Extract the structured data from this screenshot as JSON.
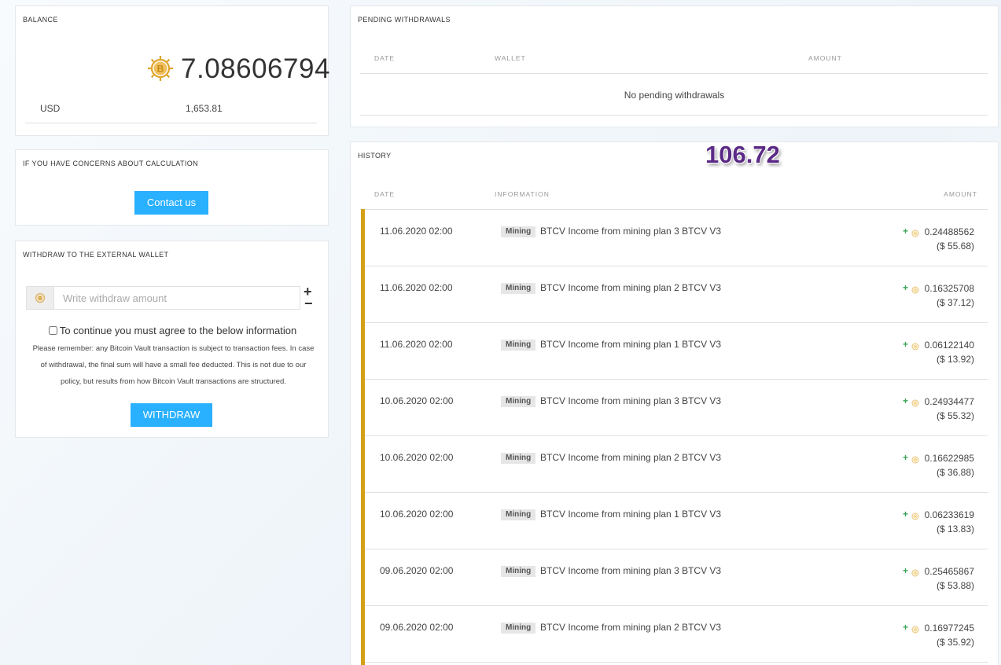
{
  "balance": {
    "title": "BALANCE",
    "amount": "7.08606794",
    "coin_icon": "bitcoin-vault-icon",
    "usd_label": "USD",
    "usd_value": "1,653.81"
  },
  "concerns": {
    "title": "IF YOU HAVE CONCERNS ABOUT CALCULATION",
    "contact_label": "Contact us"
  },
  "withdraw": {
    "title": "WITHDRAW TO THE EXTERNAL WALLET",
    "placeholder": "Write withdraw amount",
    "plus": "+",
    "minus": "−",
    "agree_label": "To continue you must agree to the below information",
    "notice": "Please remember: any Bitcoin Vault transaction is subject to transaction fees. In case of withdrawal, the final sum will have a small fee deducted. This is not due to our policy, but results from how Bitcoin Vault transactions are structured.",
    "button_label": "WITHDRAW"
  },
  "pending": {
    "title": "PENDING WITHDRAWALS",
    "columns": [
      "DATE",
      "WALLET",
      "AMOUNT"
    ],
    "empty_text": "No pending withdrawals"
  },
  "history": {
    "title": "HISTORY",
    "overlay_value": "106.72",
    "columns": [
      "DATE",
      "INFORMATION",
      "AMOUNT"
    ],
    "rows": [
      {
        "date": "11.06.2020 02:00",
        "badge": "Mining",
        "info": "BTCV Income from mining plan 3 BTCV V3",
        "sign": "+",
        "amount": "0.24488562",
        "usd": "($ 55.68)"
      },
      {
        "date": "11.06.2020 02:00",
        "badge": "Mining",
        "info": "BTCV Income from mining plan 2 BTCV V3",
        "sign": "+",
        "amount": "0.16325708",
        "usd": "($ 37.12)"
      },
      {
        "date": "11.06.2020 02:00",
        "badge": "Mining",
        "info": "BTCV Income from mining plan 1 BTCV V3",
        "sign": "+",
        "amount": "0.06122140",
        "usd": "($ 13.92)"
      },
      {
        "date": "10.06.2020 02:00",
        "badge": "Mining",
        "info": "BTCV Income from mining plan 3 BTCV V3",
        "sign": "+",
        "amount": "0.24934477",
        "usd": "($ 55.32)"
      },
      {
        "date": "10.06.2020 02:00",
        "badge": "Mining",
        "info": "BTCV Income from mining plan 2 BTCV V3",
        "sign": "+",
        "amount": "0.16622985",
        "usd": "($ 36.88)"
      },
      {
        "date": "10.06.2020 02:00",
        "badge": "Mining",
        "info": "BTCV Income from mining plan 1 BTCV V3",
        "sign": "+",
        "amount": "0.06233619",
        "usd": "($ 13.83)"
      },
      {
        "date": "09.06.2020 02:00",
        "badge": "Mining",
        "info": "BTCV Income from mining plan 3 BTCV V3",
        "sign": "+",
        "amount": "0.25465867",
        "usd": "($ 53.88)"
      },
      {
        "date": "09.06.2020 02:00",
        "badge": "Mining",
        "info": "BTCV Income from mining plan 2 BTCV V3",
        "sign": "+",
        "amount": "0.16977245",
        "usd": "($ 35.92)"
      }
    ]
  },
  "colors": {
    "accent_blue": "#29b0ff",
    "coin_gold": "#d4a017",
    "history_bar": "#d4a017",
    "positive_green": "#3aa655",
    "overlay_purple": "#5b2a86"
  }
}
